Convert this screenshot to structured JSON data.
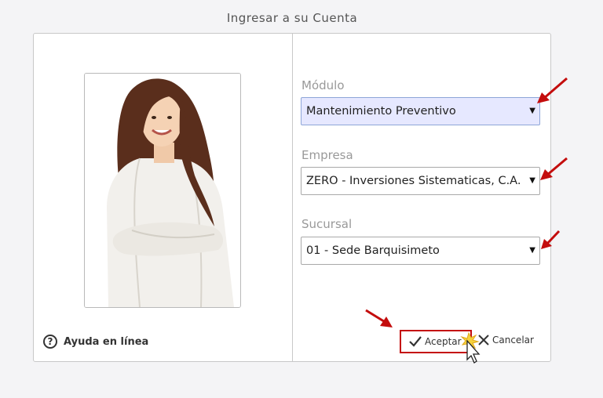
{
  "dialog": {
    "title": "Ingresar a su Cuenta"
  },
  "help": {
    "icon": "question-circle-icon",
    "label": "Ayuda en línea"
  },
  "fields": {
    "modulo": {
      "label": "Módulo",
      "value": "Mantenimiento Preventivo"
    },
    "empresa": {
      "label": "Empresa",
      "value": "ZERO - Inversiones Sistematicas, C.A."
    },
    "sucursal": {
      "label": "Sucursal",
      "value": "01 - Sede Barquisimeto"
    }
  },
  "buttons": {
    "accept": {
      "label": "Aceptar",
      "icon": "checkmark-icon"
    },
    "cancel": {
      "label": "Cancelar",
      "icon": "close-icon"
    }
  },
  "colors": {
    "highlight_red": "#c40d0d",
    "active_field_bg": "#e6e8ff"
  }
}
